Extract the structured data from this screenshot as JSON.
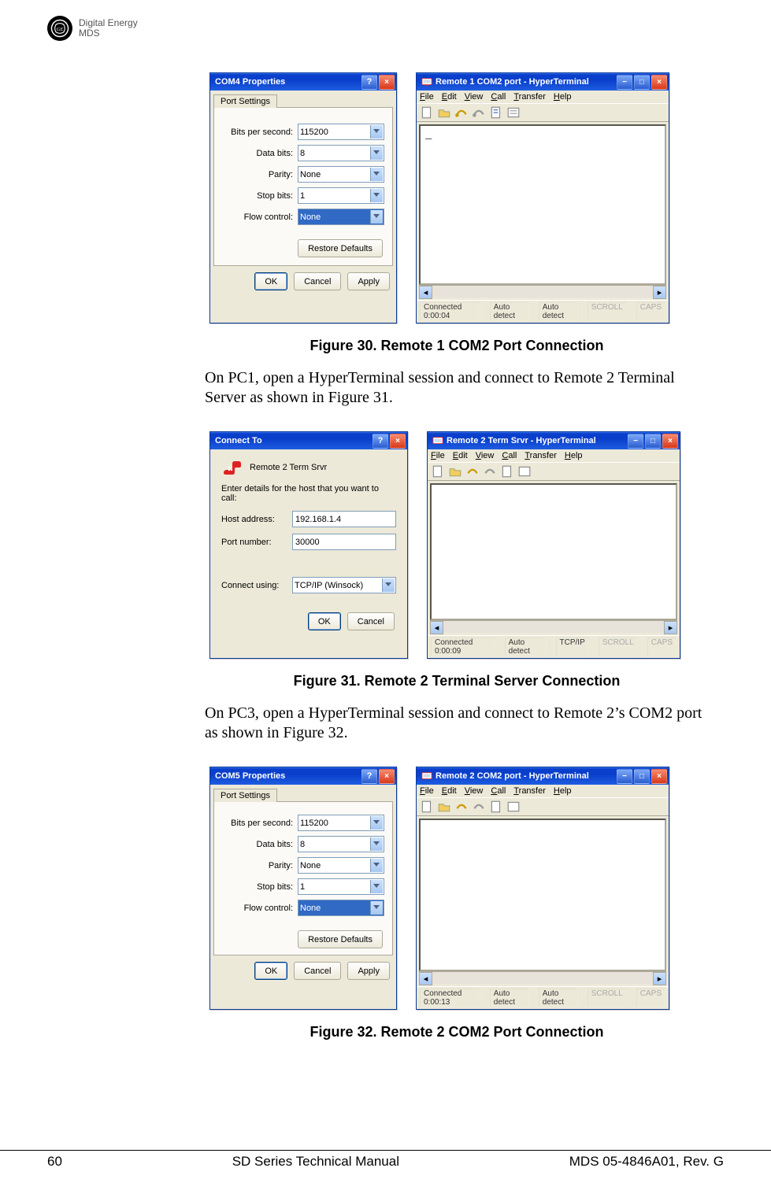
{
  "header": {
    "brand1": "Digital Energy",
    "brand2": "MDS"
  },
  "fig30": {
    "caption": "Figure 30. Remote 1 COM2 Port Connection",
    "dialog": {
      "title": "COM4 Properties",
      "tab": "Port Settings",
      "rows": {
        "bps_label": "Bits per second:",
        "bps_value": "115200",
        "databits_label": "Data bits:",
        "databits_value": "8",
        "parity_label": "Parity:",
        "parity_value": "None",
        "stopbits_label": "Stop bits:",
        "stopbits_value": "1",
        "flow_label": "Flow control:",
        "flow_value": "None"
      },
      "restore": "Restore Defaults",
      "ok": "OK",
      "cancel": "Cancel",
      "apply": "Apply"
    },
    "ht": {
      "title": "Remote 1 COM2 port - HyperTerminal",
      "menu": [
        "File",
        "Edit",
        "View",
        "Call",
        "Transfer",
        "Help"
      ],
      "output": "_",
      "status": {
        "conn": "Connected 0:00:04",
        "a": "Auto detect",
        "b": "Auto detect",
        "c": "SCROLL",
        "d": "CAPS"
      }
    }
  },
  "body1": "On PC1, open a HyperTerminal session and connect to Remote 2 Terminal Server as shown in Figure 31.",
  "fig31": {
    "caption": "Figure 31. Remote 2 Terminal Server Connection",
    "ct": {
      "title": "Connect To",
      "name": "Remote 2 Term Srvr",
      "prompt": "Enter details for the host that you want to call:",
      "host_label": "Host address:",
      "host_value": "192.168.1.4",
      "port_label": "Port number:",
      "port_value": "30000",
      "connect_label": "Connect using:",
      "connect_value": "TCP/IP (Winsock)",
      "ok": "OK",
      "cancel": "Cancel"
    },
    "ht": {
      "title": "Remote 2 Term Srvr - HyperTerminal",
      "menu": [
        "File",
        "Edit",
        "View",
        "Call",
        "Transfer",
        "Help"
      ],
      "status": {
        "conn": "Connected 0:00:09",
        "a": "Auto detect",
        "b": "TCP/IP",
        "c": "SCROLL",
        "d": "CAPS"
      }
    }
  },
  "body2": "On PC3, open a HyperTerminal session and connect to Remote 2’s COM2 port as shown in Figure 32.",
  "fig32": {
    "caption": "Figure 32. Remote 2 COM2 Port Connection",
    "dialog": {
      "title": "COM5 Properties",
      "tab": "Port Settings",
      "rows": {
        "bps_label": "Bits per second:",
        "bps_value": "115200",
        "databits_label": "Data bits:",
        "databits_value": "8",
        "parity_label": "Parity:",
        "parity_value": "None",
        "stopbits_label": "Stop bits:",
        "stopbits_value": "1",
        "flow_label": "Flow control:",
        "flow_value": "None"
      },
      "restore": "Restore Defaults",
      "ok": "OK",
      "cancel": "Cancel",
      "apply": "Apply"
    },
    "ht": {
      "title": "Remote 2 COM2 port - HyperTerminal",
      "menu": [
        "File",
        "Edit",
        "View",
        "Call",
        "Transfer",
        "Help"
      ],
      "status": {
        "conn": "Connected 0:00:13",
        "a": "Auto detect",
        "b": "Auto detect",
        "c": "SCROLL",
        "d": "CAPS"
      }
    }
  },
  "footer": {
    "left": "60",
    "center": "SD Series Technical Manual",
    "right": "MDS 05-4846A01, Rev. G"
  }
}
